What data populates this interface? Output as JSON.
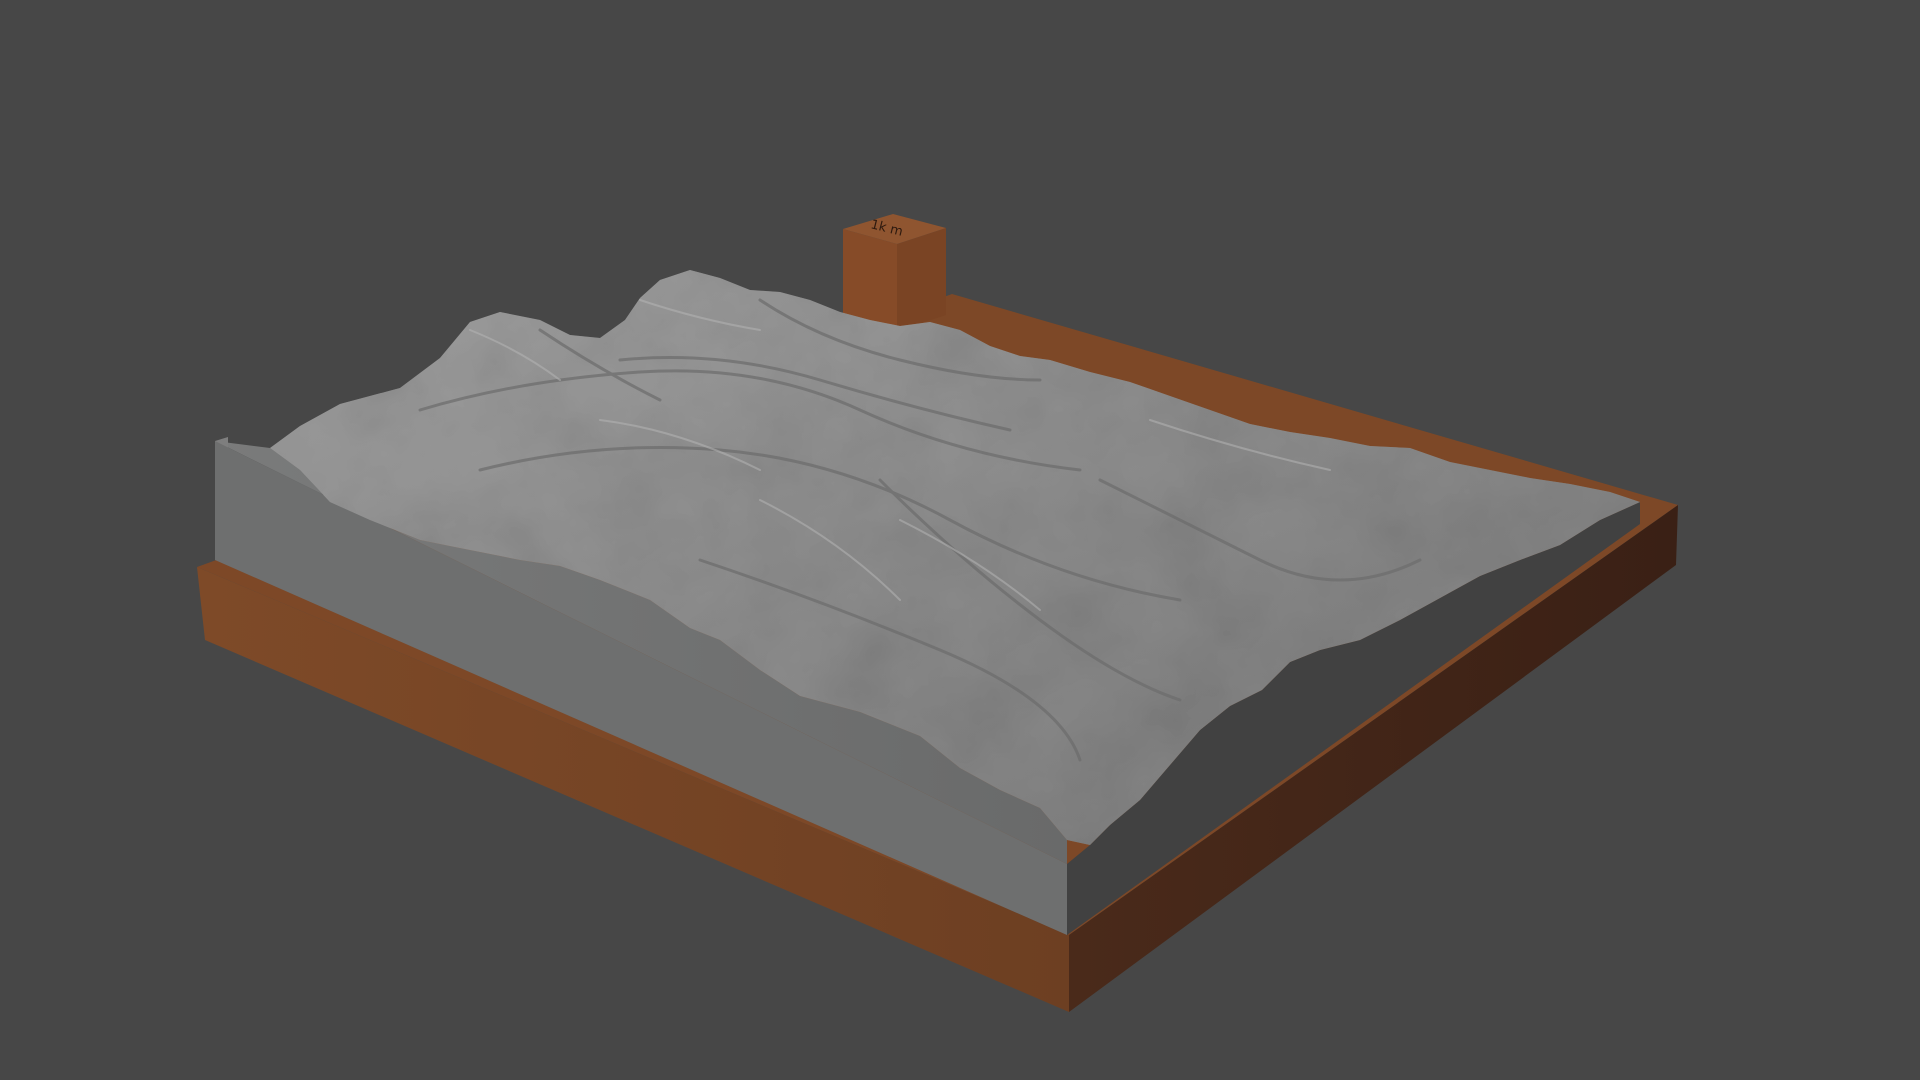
{
  "scene": {
    "background_color": "#474747",
    "objects": {
      "base": {
        "name": "terrain-base-plate",
        "color": "#7a4726",
        "shadow_color": "#3d2216"
      },
      "terrain": {
        "name": "relief-terrain-model",
        "color": "#8c8c8c",
        "side_color": "#6d6e6e",
        "shadow_side_color": "#414141"
      },
      "marker": {
        "name": "scale-marker-block",
        "color": "#834a28",
        "side_color": "#5e321a",
        "engraving": "1k m"
      }
    }
  }
}
